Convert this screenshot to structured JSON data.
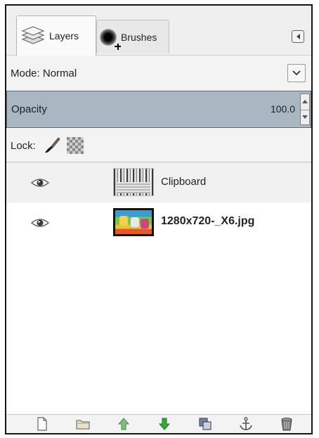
{
  "tabs": [
    {
      "label": "Layers",
      "icon": "layers-icon",
      "active": true
    },
    {
      "label": "Brushes",
      "icon": "brush-icon",
      "active": false
    }
  ],
  "mode": {
    "label": "Mode:",
    "value": "Normal"
  },
  "opacity": {
    "label": "Opacity",
    "value": "100.0"
  },
  "lock": {
    "label": "Lock:"
  },
  "layers": [
    {
      "name": "Clipboard",
      "visible": true,
      "bold": false
    },
    {
      "name": "1280x720-_X6.jpg",
      "visible": true,
      "bold": true
    }
  ],
  "colors": {
    "opacity_bar": "#a9b7c3",
    "move_up_arrow": "#7fbf7f",
    "move_down_arrow": "#33aa33"
  },
  "bottom_icons": [
    "new-layer-icon",
    "new-layer-group-icon",
    "raise-layer-icon",
    "lower-layer-icon",
    "duplicate-layer-icon",
    "anchor-layer-icon",
    "delete-layer-icon"
  ]
}
